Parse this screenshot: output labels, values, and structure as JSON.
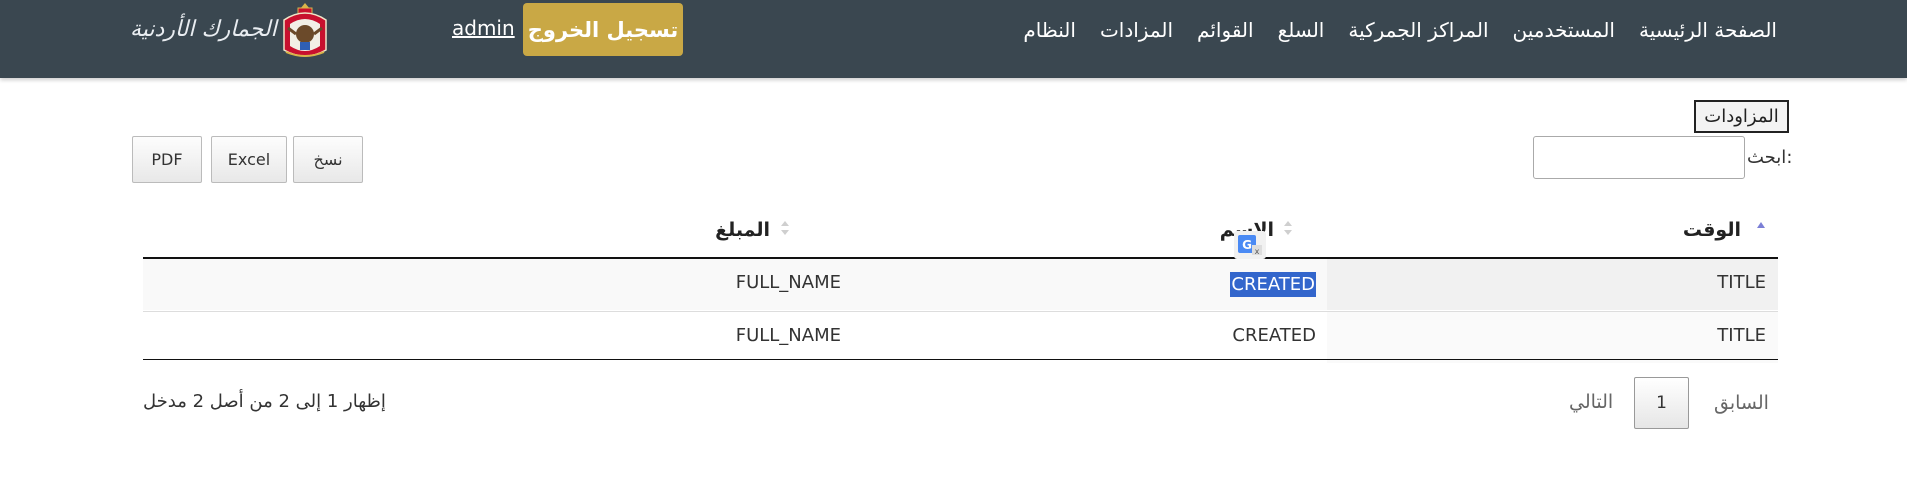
{
  "navbar": {
    "menu": [
      "الصفحة الرئيسية",
      "المستخدمين",
      "المراكز الجمركية",
      "السلع",
      "القوائم",
      "المزادات",
      "النظام"
    ],
    "logout_label": "تسجيل الخروج",
    "user_link": "admin",
    "logo_text": "الجمارك الأردنية",
    "colors": {
      "bar": "#3a4750",
      "logout": "#c9a845"
    }
  },
  "page": {
    "tag_label": "المزاودات",
    "search_label": "ابحث:",
    "search_value": "",
    "buttons": {
      "copy": "نسخ",
      "excel": "Excel",
      "pdf": "PDF"
    }
  },
  "table": {
    "headers": {
      "time": "الوقت",
      "name": "الاسم",
      "amount": "المبلغ"
    },
    "rows": [
      {
        "time": "TITLE",
        "name": "CREATED",
        "amount": "FULL_NAME"
      },
      {
        "time": "TITLE",
        "name": "CREATED",
        "amount": "FULL_NAME"
      }
    ]
  },
  "footer": {
    "info": "إظهار 1 إلى 2 من أصل 2 مدخل",
    "previous": "السابق",
    "next": "التالي",
    "page": "1"
  }
}
